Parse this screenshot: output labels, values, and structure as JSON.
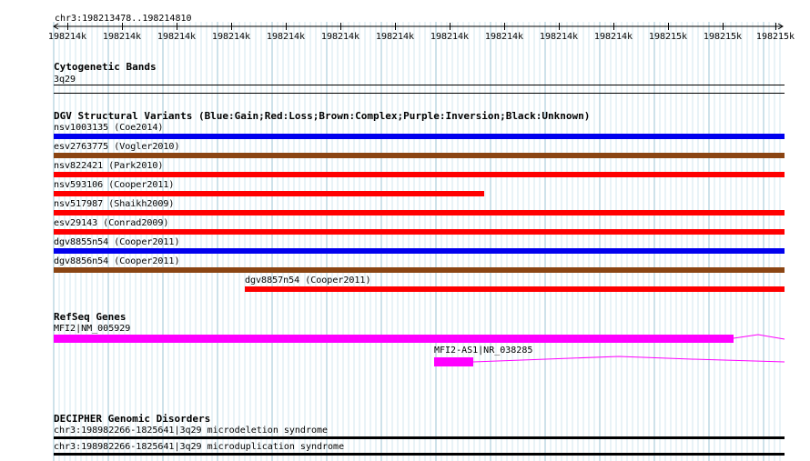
{
  "browser": {
    "location": "chr3:198213478..198214810",
    "ruler_ticks": [
      "198214k",
      "198214k",
      "198214k",
      "198214k",
      "198214k",
      "198214k",
      "198214k",
      "198214k",
      "198214k",
      "198214k",
      "198214k",
      "198215k",
      "198215k",
      "198215k"
    ]
  },
  "tracks": {
    "cytobands": {
      "title": "Cytogenetic Bands",
      "band": "3q29"
    },
    "dgv": {
      "title": "DGV Structural Variants (Blue:Gain;Red:Loss;Brown:Complex;Purple:Inversion;Black:Unknown)",
      "features": [
        {
          "label": "nsv1003135 (Coe2014)",
          "color": "#0000ee",
          "type": "gain"
        },
        {
          "label": "esv2763775 (Vogler2010)",
          "color": "#8b4513",
          "type": "complex"
        },
        {
          "label": "nsv822421 (Park2010)",
          "color": "#ff0000",
          "type": "loss"
        },
        {
          "label": "nsv593106 (Cooper2011)",
          "color": "#ff0000",
          "type": "loss"
        },
        {
          "label": "nsv517987 (Shaikh2009)",
          "color": "#ff0000",
          "type": "loss"
        },
        {
          "label": "esv29143 (Conrad2009)",
          "color": "#ff0000",
          "type": "loss"
        },
        {
          "label": "dgv8855n54 (Cooper2011)",
          "color": "#0000ee",
          "type": "gain"
        },
        {
          "label": "dgv8856n54 (Cooper2011)",
          "color": "#8b4513",
          "type": "complex"
        },
        {
          "label": "dgv8857n54 (Cooper2011)",
          "color": "#ff0000",
          "type": "loss"
        }
      ]
    },
    "refseq": {
      "title": "RefSeq Genes",
      "genes": [
        {
          "label": "MFI2|NM_005929"
        },
        {
          "label": "MFI2-AS1|NR_038285"
        }
      ],
      "color": "#ff00ff"
    },
    "decipher": {
      "title": "DECIPHER Genomic Disorders",
      "features": [
        {
          "label": "chr3:198982266-1825641|3q29 microdeletion syndrome"
        },
        {
          "label": "chr3:198982266-1825641|3q29 microduplication syndrome"
        }
      ]
    }
  }
}
